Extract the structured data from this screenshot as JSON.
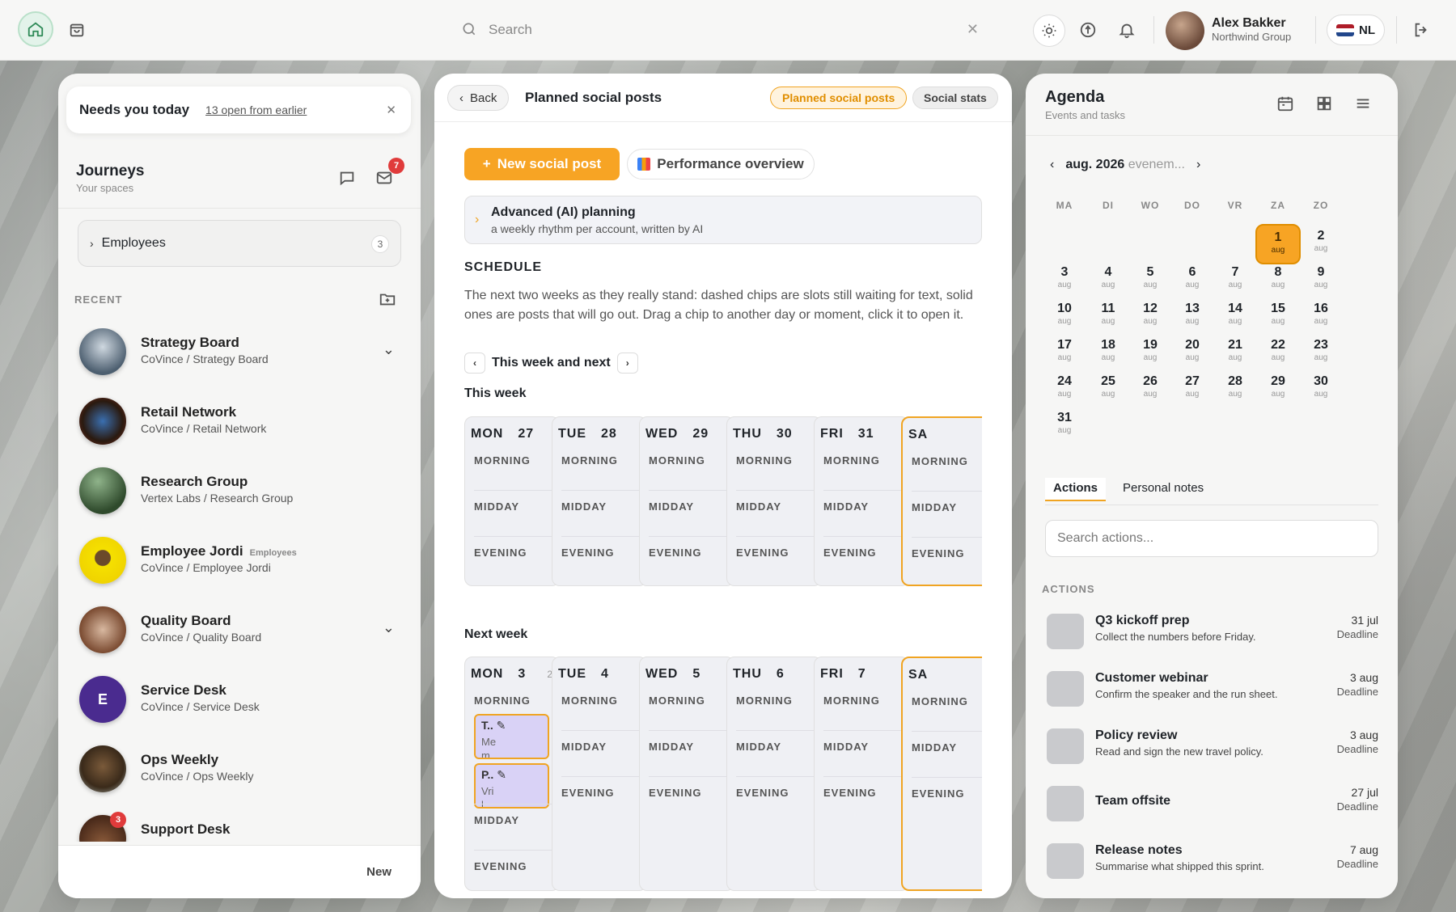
{
  "topbar": {
    "search_placeholder": "Search",
    "user_name": "Alex Bakker",
    "user_org": "Northwind Group",
    "language": "NL"
  },
  "left": {
    "needs_title": "Needs you today",
    "needs_link": "13 open from earlier",
    "journeys_title": "Journeys",
    "journeys_sub": "Your spaces",
    "mail_badge": "7",
    "employees_label": "Employees",
    "employees_count": "3",
    "recent_label": "RECENT",
    "items": [
      {
        "name": "Strategy Board",
        "path": "CoVince / Strategy Board",
        "tag": ""
      },
      {
        "name": "Retail Network",
        "path": "CoVince / Retail Network",
        "tag": ""
      },
      {
        "name": "Research Group",
        "path": "Vertex Labs / Research Group",
        "tag": ""
      },
      {
        "name": "Employee Jordi",
        "path": "CoVince / Employee Jordi",
        "tag": "Employees"
      },
      {
        "name": "Quality Board",
        "path": "CoVince / Quality Board",
        "tag": ""
      },
      {
        "name": "Service Desk",
        "path": "CoVince / Service Desk",
        "tag": "",
        "initial": "E"
      },
      {
        "name": "Ops Weekly",
        "path": "CoVince / Ops Weekly",
        "tag": ""
      },
      {
        "name": "Support Desk",
        "path": "",
        "tag": "",
        "badge": "3"
      }
    ],
    "footer_new": "New"
  },
  "middle": {
    "back": "Back",
    "title": "Planned social posts",
    "pill_active": "Planned social posts",
    "pill_other": "Social stats",
    "new_post": "New social post",
    "performance": "Performance overview",
    "adv_title": "Advanced (AI) planning",
    "adv_sub": "a weekly rhythm per account, written by AI",
    "schedule_heading": "SCHEDULE",
    "schedule_desc": "The next two weeks as they really stand: dashed chips are slots still waiting for text, solid ones are posts that will go out. Drag a chip to another day or moment, click it to open it.",
    "range_label": "This week and next",
    "this_week": "This week",
    "next_week": "Next week",
    "slots": {
      "morning": "MORNING",
      "midday": "MIDDAY",
      "evening": "EVENING"
    },
    "week1": [
      {
        "dow": "MON",
        "num": "27"
      },
      {
        "dow": "TUE",
        "num": "28"
      },
      {
        "dow": "WED",
        "num": "29"
      },
      {
        "dow": "THU",
        "num": "30"
      },
      {
        "dow": "FRI",
        "num": "31"
      },
      {
        "dow": "SA",
        "num": ""
      }
    ],
    "week2": [
      {
        "dow": "MON",
        "num": "3",
        "count": "2"
      },
      {
        "dow": "TUE",
        "num": "4"
      },
      {
        "dow": "WED",
        "num": "5"
      },
      {
        "dow": "THU",
        "num": "6"
      },
      {
        "dow": "FRI",
        "num": "7"
      },
      {
        "dow": "SA",
        "num": ""
      }
    ],
    "chips": [
      {
        "title": "T.. ✎",
        "body": "Me\nm."
      },
      {
        "title": "P.. ✎",
        "body": "Vri\nl..."
      }
    ]
  },
  "right": {
    "title": "Agenda",
    "subtitle": "Events and tasks",
    "month": "aug. 2026",
    "month_sub": "evenem...",
    "dow": [
      "MA",
      "DI",
      "WO",
      "DO",
      "VR",
      "ZA",
      "ZO"
    ],
    "month_abbr": "aug",
    "today": "1",
    "tabs": [
      "Actions",
      "Personal notes"
    ],
    "search_placeholder": "Search actions...",
    "actions_label": "ACTIONS",
    "actions": [
      {
        "title": "Q3 kickoff prep",
        "desc": "Collect the numbers before Friday.",
        "date": "31 jul",
        "label": "Deadline"
      },
      {
        "title": "Customer webinar",
        "desc": "Confirm the speaker and the run sheet.",
        "date": "3 aug",
        "label": "Deadline"
      },
      {
        "title": "Policy review",
        "desc": "Read and sign the new travel policy.",
        "date": "3 aug",
        "label": "Deadline"
      },
      {
        "title": "Team offsite",
        "desc": "",
        "date": "27 jul",
        "label": "Deadline"
      },
      {
        "title": "Release notes",
        "desc": "Summarise what shipped this sprint.",
        "date": "7 aug",
        "label": "Deadline"
      }
    ]
  }
}
